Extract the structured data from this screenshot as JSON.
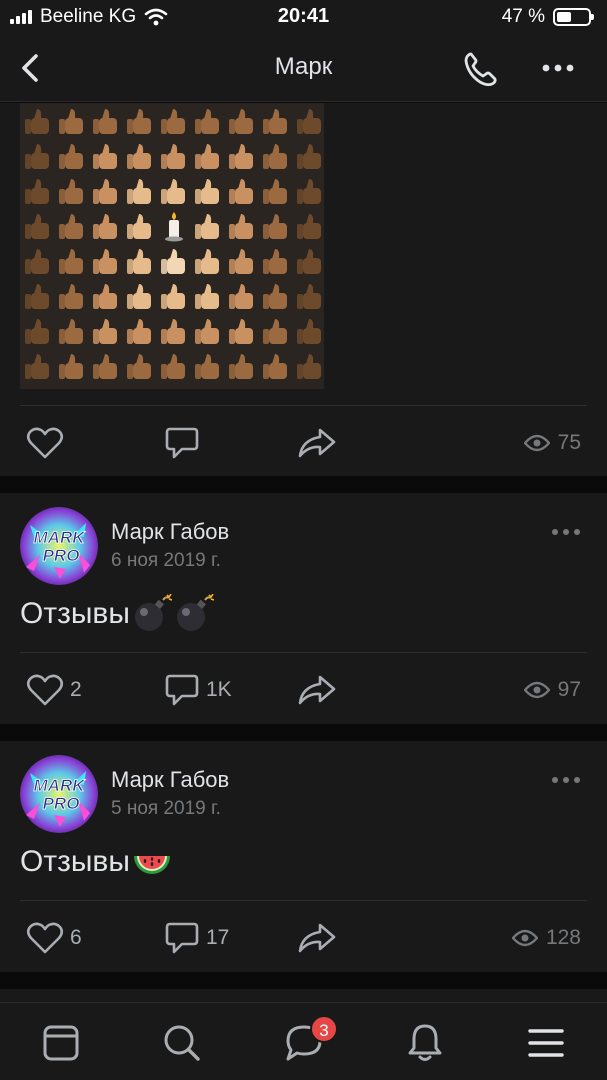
{
  "status_bar": {
    "carrier": "Beeline KG",
    "time": "20:41",
    "battery_text": "47 %",
    "battery_level": 0.47
  },
  "nav": {
    "title": "Марк",
    "icons": [
      "back-chevron-icon",
      "phone-icon",
      "more-dots-icon"
    ]
  },
  "posts": [
    {
      "image_content": "grid of thumbs-up emoji in various skin tones with a candle in the center",
      "likes": "",
      "comments": "",
      "views": "75"
    },
    {
      "author": "Марк Габов",
      "date": "6 ноя 2019 г.",
      "text": "Отзывы",
      "emoji": [
        "bomb",
        "bomb"
      ],
      "likes": "2",
      "comments": "1K",
      "views": "97"
    },
    {
      "author": "Марк Габов",
      "date": "5 ноя 2019 г.",
      "text": "Отзывы",
      "emoji": [
        "watermelon"
      ],
      "likes": "6",
      "comments": "17",
      "views": "128"
    }
  ],
  "avatar_text": [
    "MARK",
    "PRO"
  ],
  "tab_bar": {
    "items": [
      "news-icon",
      "search-icon",
      "messages-icon",
      "notifications-icon",
      "menu-icon"
    ],
    "messages_badge": "3"
  },
  "colors": {
    "background": "#0a0a0a",
    "card": "#19191a",
    "text": "#e1e3e6",
    "secondary": "#76787a",
    "icon": "#aaaeb3",
    "badge": "#e64646"
  }
}
